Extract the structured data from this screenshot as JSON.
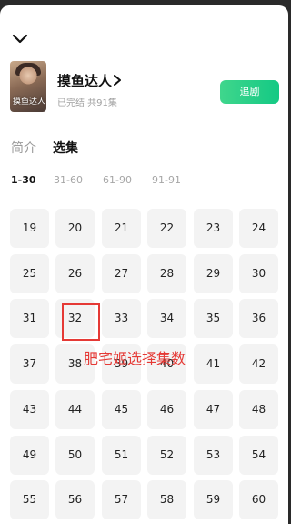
{
  "header": {
    "collapse_icon": "chevron-down-icon"
  },
  "drama": {
    "poster_text": "摸鱼达人",
    "title": "摸鱼达人",
    "title_arrow_icon": "chevron-right-icon",
    "meta": "已完结 共91集",
    "follow_label": "追剧",
    "follow_color": "#1ecb86"
  },
  "tabs": [
    {
      "label": "简介",
      "active": false
    },
    {
      "label": "选集",
      "active": true
    }
  ],
  "ranges": [
    {
      "label": "1-30",
      "active": true
    },
    {
      "label": "31-60",
      "active": false
    },
    {
      "label": "61-90",
      "active": false
    },
    {
      "label": "91-91",
      "active": false
    }
  ],
  "episodes": [
    "19",
    "20",
    "21",
    "22",
    "23",
    "24",
    "25",
    "26",
    "27",
    "28",
    "29",
    "30",
    "31",
    "32",
    "33",
    "34",
    "35",
    "36",
    "37",
    "38",
    "39",
    "40",
    "41",
    "42",
    "43",
    "44",
    "45",
    "46",
    "47",
    "48",
    "49",
    "50",
    "51",
    "52",
    "53",
    "54",
    "55",
    "56",
    "57",
    "58",
    "59",
    "60"
  ],
  "annotation": {
    "text": "肥宅姬选择集数",
    "highlighted_episode": "32",
    "color": "#e53935"
  }
}
